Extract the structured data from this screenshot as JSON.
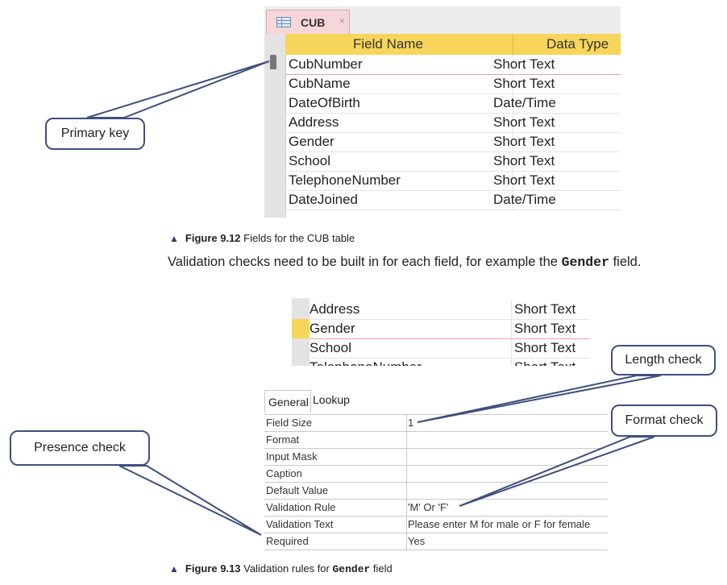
{
  "figure_1": {
    "tab_label": "CUB",
    "tab_close": "×",
    "headers": {
      "field": "Field Name",
      "type": "Data Type"
    },
    "rows": [
      {
        "field": "CubNumber",
        "type": "Short Text"
      },
      {
        "field": "CubName",
        "type": "Short Text"
      },
      {
        "field": "DateOfBirth",
        "type": "Date/Time"
      },
      {
        "field": "Address",
        "type": "Short Text"
      },
      {
        "field": "Gender",
        "type": "Short Text"
      },
      {
        "field": "School",
        "type": "Short Text"
      },
      {
        "field": "TelephoneNumber",
        "type": "Short Text"
      },
      {
        "field": "DateJoined",
        "type": "Date/Time"
      }
    ],
    "callout_primary": "Primary key",
    "caption_number": "Figure 9.12",
    "caption_text": "Fields for the CUB table"
  },
  "paragraph": {
    "before": "Validation checks need to be built in for each field, for example the ",
    "code": "Gender",
    "after": " field."
  },
  "figure_2": {
    "rows": [
      {
        "field": "Address",
        "type": "Short Text"
      },
      {
        "field": "Gender",
        "type": "Short Text"
      },
      {
        "field": "School",
        "type": "Short Text"
      },
      {
        "field": "TelephoneNumber",
        "type": "Short Text"
      }
    ],
    "tabs": {
      "general": "General",
      "lookup": "Lookup"
    },
    "properties": [
      {
        "label": "Field Size",
        "value": "1"
      },
      {
        "label": "Format",
        "value": ""
      },
      {
        "label": "Input Mask",
        "value": ""
      },
      {
        "label": "Caption",
        "value": ""
      },
      {
        "label": "Default Value",
        "value": ""
      },
      {
        "label": "Validation Rule",
        "value": "'M' Or 'F'"
      },
      {
        "label": "Validation Text",
        "value": "Please enter M for male or F for female"
      },
      {
        "label": "Required",
        "value": "Yes"
      }
    ],
    "callout_length": "Length check",
    "callout_format": "Format check",
    "callout_presence": "Presence check",
    "caption_number": "Figure 9.13",
    "caption_before": "Validation rules for ",
    "caption_code": "Gender",
    "caption_after": " field"
  },
  "colors": {
    "header_yellow": "#f7d55a",
    "tab_pink": "#f7d6d9",
    "callout_border": "#3e4f7e"
  }
}
